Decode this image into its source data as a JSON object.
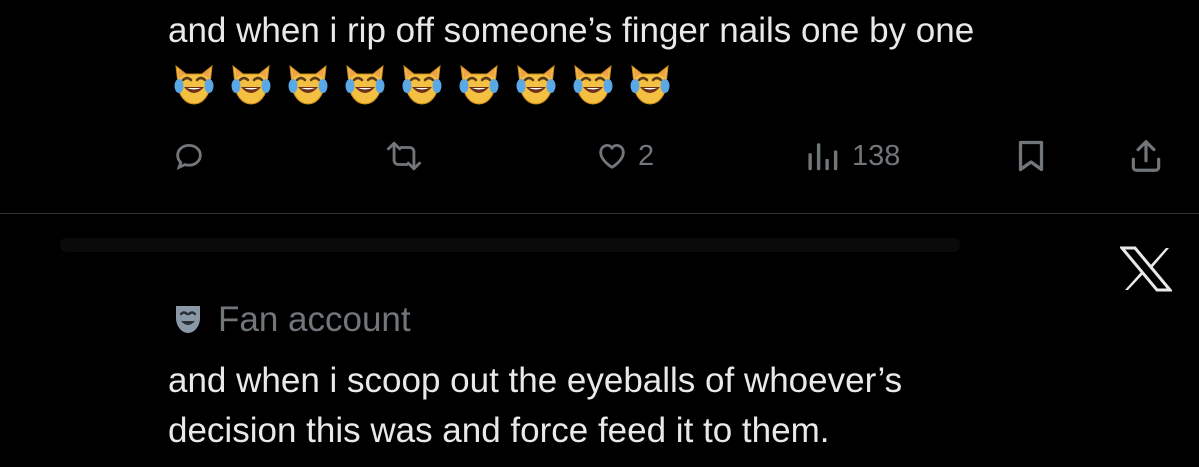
{
  "tweet": {
    "text": "and when i rip off someone’s finger nails one by one",
    "emoji_name": "crying-laughing-cat-emoji",
    "emoji_count": 9
  },
  "actions": {
    "reply_icon": "speech-bubble-icon",
    "retweet_icon": "retweet-icon",
    "like_icon": "heart-icon",
    "like_count": "2",
    "views_icon": "bar-chart-icon",
    "views_count": "138",
    "bookmark_icon": "bookmark-icon",
    "share_icon": "share-upload-icon"
  },
  "branding": {
    "logo": "x-logo-icon"
  },
  "reply": {
    "badge_icon": "theater-mask-icon",
    "author": "Fan account",
    "text_line1": "and when i scoop out the eyeballs of whoever’s",
    "text_line2": "decision this was and force feed it to them."
  },
  "colors": {
    "background": "#000000",
    "text": "#e7e9ea",
    "muted": "#71767b",
    "divider": "#2f3336"
  }
}
